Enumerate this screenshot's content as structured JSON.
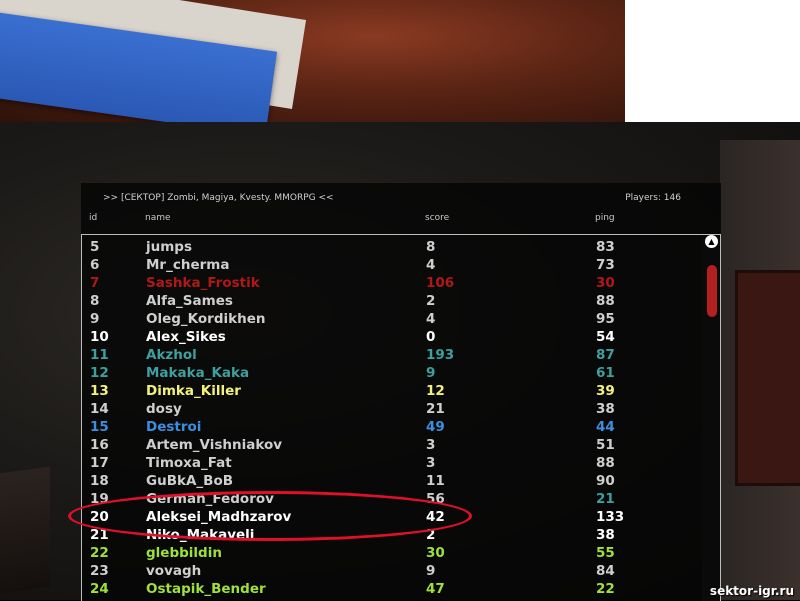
{
  "server": {
    "title": ">> [СЕКТОР] Zombi, Magiya, Kvesty. MMORPG <<",
    "players_label": "Players: 146"
  },
  "columns": {
    "id": "id",
    "name": "name",
    "score": "score",
    "ping": "ping"
  },
  "players": [
    {
      "id": "5",
      "name": "jumps",
      "score": "8",
      "ping": "83",
      "color": "#cfcfcf"
    },
    {
      "id": "6",
      "name": "Mr_cherma",
      "score": "4",
      "ping": "73",
      "color": "#cfcfcf"
    },
    {
      "id": "7",
      "name": "Sashka_Frostik",
      "score": "106",
      "ping": "30",
      "color": "#b01818"
    },
    {
      "id": "8",
      "name": "Alfa_Sames",
      "score": "2",
      "ping": "88",
      "color": "#cfcfcf"
    },
    {
      "id": "9",
      "name": "Oleg_Kordikhen",
      "score": "4",
      "ping": "95",
      "color": "#cfcfcf"
    },
    {
      "id": "10",
      "name": "Alex_Sikes",
      "score": "0",
      "ping": "54",
      "color": "#ffffff"
    },
    {
      "id": "11",
      "name": "Akzhol",
      "score": "193",
      "ping": "87",
      "color": "#3f9f9f"
    },
    {
      "id": "12",
      "name": "Makaka_Kaka",
      "score": "9",
      "ping": "61",
      "color": "#3f9f9f"
    },
    {
      "id": "13",
      "name": "Dimka_Killer",
      "score": "12",
      "ping": "39",
      "color": "#f2f27a"
    },
    {
      "id": "14",
      "name": "dosy",
      "score": "21",
      "ping": "38",
      "color": "#cfcfcf"
    },
    {
      "id": "15",
      "name": "Destroi",
      "score": "49",
      "ping": "44",
      "color": "#3c8fe0"
    },
    {
      "id": "16",
      "name": "Artem_Vishniakov",
      "score": "3",
      "ping": "51",
      "color": "#cfcfcf"
    },
    {
      "id": "17",
      "name": "Timoxa_Fat",
      "score": "3",
      "ping": "88",
      "color": "#cfcfcf"
    },
    {
      "id": "18",
      "name": "GuBkA_BoB",
      "score": "11",
      "ping": "90",
      "color": "#cfcfcf"
    },
    {
      "id": "19",
      "name": "German_Fedorov",
      "score": "56",
      "ping": "21",
      "color": "#cfcfcf",
      "ping_color": "#3f9f9f"
    },
    {
      "id": "20",
      "name": "Aleksei_Madhzarov",
      "score": "42",
      "ping": "133",
      "color": "#ffffff"
    },
    {
      "id": "21",
      "name": "Niko_Makaveli",
      "score": "2",
      "ping": "38",
      "color": "#ffffff"
    },
    {
      "id": "22",
      "name": "glebbildin",
      "score": "30",
      "ping": "55",
      "color": "#9fe03a"
    },
    {
      "id": "23",
      "name": "vovagh",
      "score": "9",
      "ping": "84",
      "color": "#cfcfcf"
    },
    {
      "id": "24",
      "name": "Ostapik_Bender",
      "score": "47",
      "ping": "22",
      "color": "#9fe03a"
    }
  ],
  "highlight_color": "#e0102a",
  "watermark": "sektor-igr.ru",
  "icons": {
    "scroll_up": "arrow-up-icon"
  }
}
